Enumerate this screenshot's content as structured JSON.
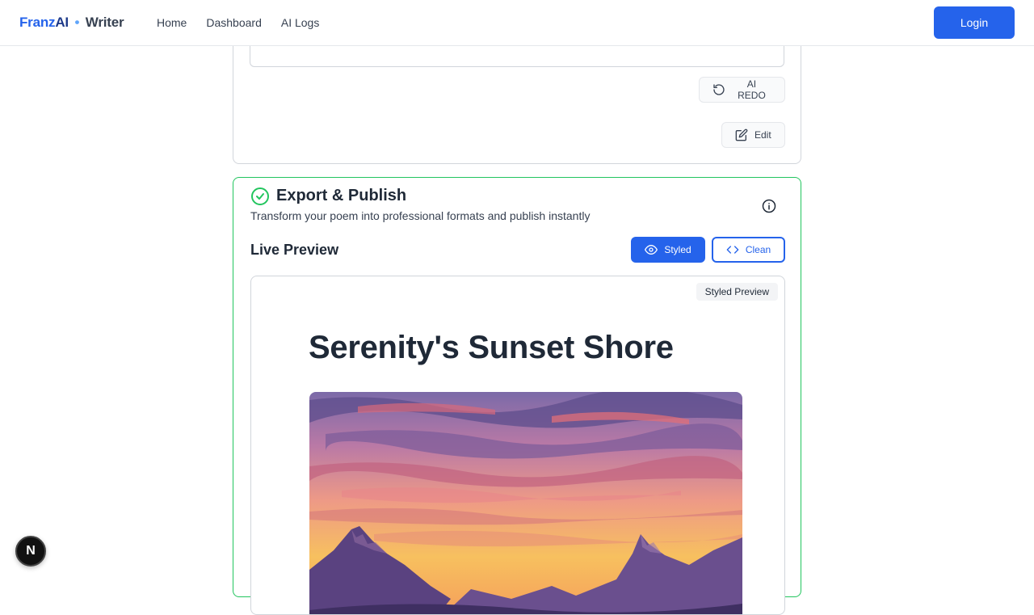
{
  "header": {
    "brand_part1": "Franz",
    "brand_part2": "AI",
    "brand_dot": "•",
    "brand_part3": "Writer",
    "nav": [
      {
        "label": "Home"
      },
      {
        "label": "Dashboard"
      },
      {
        "label": "AI Logs"
      }
    ],
    "login_label": "Login"
  },
  "step_card": {
    "textarea_value": "",
    "redo_label": "AI REDO",
    "edit_label": "Edit"
  },
  "export_card": {
    "title": "Export & Publish",
    "subtitle": "Transform your poem into professional formats and publish instantly",
    "live_preview_title": "Live Preview",
    "styled_label": "Styled",
    "clean_label": "Clean",
    "preview_badge": "Styled Preview",
    "poem_title": "Serenity's Sunset Shore"
  },
  "floating_badge": "N",
  "colors": {
    "primary": "#2563eb",
    "success": "#22c55e"
  },
  "icons": [
    "redo-icon",
    "edit-icon",
    "check-circle-icon",
    "info-icon",
    "eye-icon",
    "code-icon"
  ]
}
